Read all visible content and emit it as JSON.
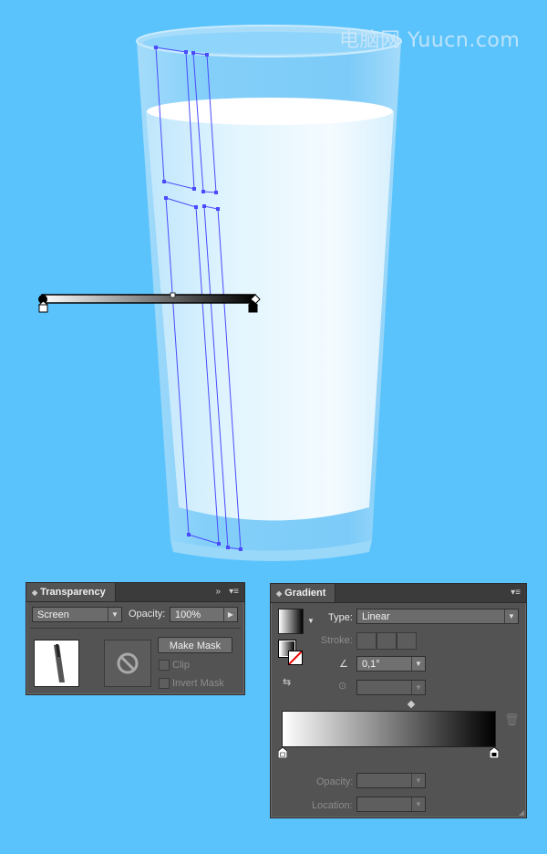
{
  "watermark": "电脑网 Yuucn.com",
  "transparency": {
    "title": "Transparency",
    "blend_mode": "Screen",
    "opacity_label": "Opacity:",
    "opacity_value": "100%",
    "make_mask": "Make Mask",
    "clip": "Clip",
    "invert_mask": "Invert Mask"
  },
  "gradient": {
    "title": "Gradient",
    "type_label": "Type:",
    "type_value": "Linear",
    "stroke_label": "Stroke:",
    "angle_value": "0,1°",
    "aspect_value": "",
    "opacity_label": "Opacity:",
    "location_label": "Location:",
    "opacity_value": "",
    "location_value": "",
    "ramp_start": "#ffffff",
    "ramp_end": "#000000"
  },
  "icons": {
    "panel_collapse": "double-arrow-icon",
    "panel_menu": "panel-menu-icon",
    "no_mask": "no-symbol-icon",
    "delete_stop": "trash-icon",
    "reverse": "reverse-gradient-icon"
  },
  "colors": {
    "background": "#5bc3fb",
    "panel": "#535353",
    "selection": "#4a4aff"
  }
}
